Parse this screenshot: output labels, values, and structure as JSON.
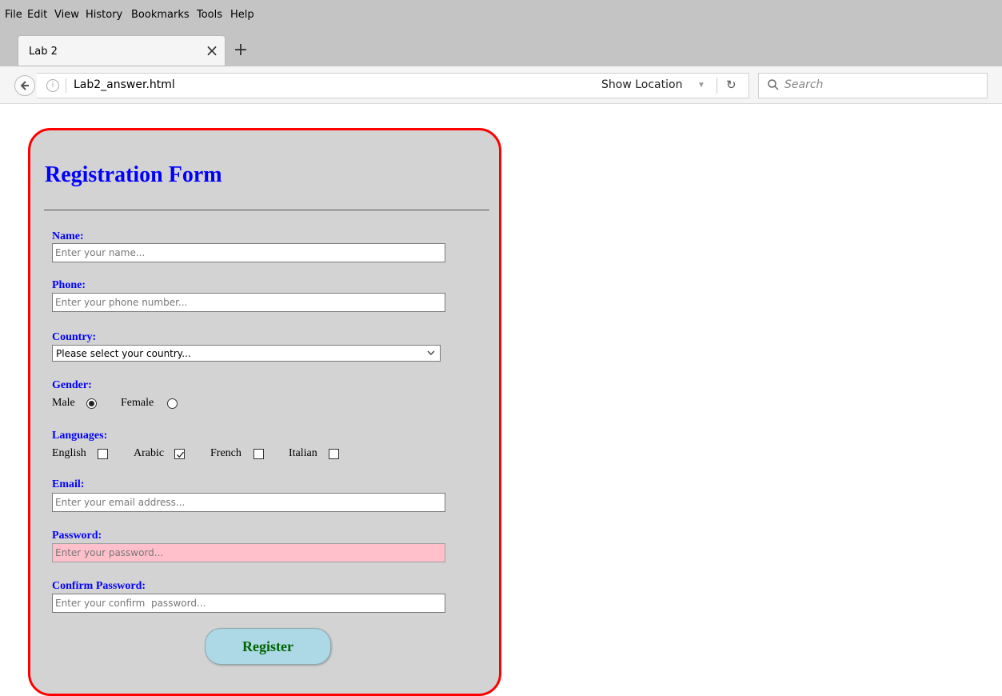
{
  "browser": {
    "menu": [
      "File",
      "Edit",
      "View",
      "History",
      "Bookmarks",
      "Tools",
      "Help"
    ],
    "tab": {
      "title": "Lab 2",
      "close_glyph": "×",
      "new_tab_glyph": "+"
    },
    "url": "Lab2_answer.html",
    "show_location": "Show Location",
    "search_placeholder": "Search"
  },
  "form": {
    "title": "Registration Form",
    "name": {
      "label": "Name:",
      "placeholder": "Enter your name..."
    },
    "phone": {
      "label": "Phone:",
      "placeholder": "Enter your phone number..."
    },
    "country": {
      "label": "Country:",
      "selected": "Please select your country..."
    },
    "gender": {
      "label": "Gender:",
      "options": [
        {
          "label": "Male",
          "checked": true
        },
        {
          "label": "Female",
          "checked": false
        }
      ]
    },
    "languages": {
      "label": "Languages:",
      "options": [
        {
          "label": "English",
          "checked": false
        },
        {
          "label": "Arabic",
          "checked": true
        },
        {
          "label": "French",
          "checked": false
        },
        {
          "label": "Italian",
          "checked": false
        }
      ]
    },
    "email": {
      "label": "Email:",
      "placeholder": "Enter your email address..."
    },
    "password": {
      "label": "Password:",
      "placeholder": "Enter your password..."
    },
    "confirm_password": {
      "label": "Confirm Password:",
      "placeholder": "Enter your confirm  password..."
    },
    "register_label": "Register"
  },
  "colors": {
    "card_border": "#ff0000",
    "card_background": "#d3d3d3",
    "label_text": "#0000ff",
    "focused_field": "#ffc0cb",
    "button_background": "#add8e6",
    "button_text": "#006400"
  }
}
